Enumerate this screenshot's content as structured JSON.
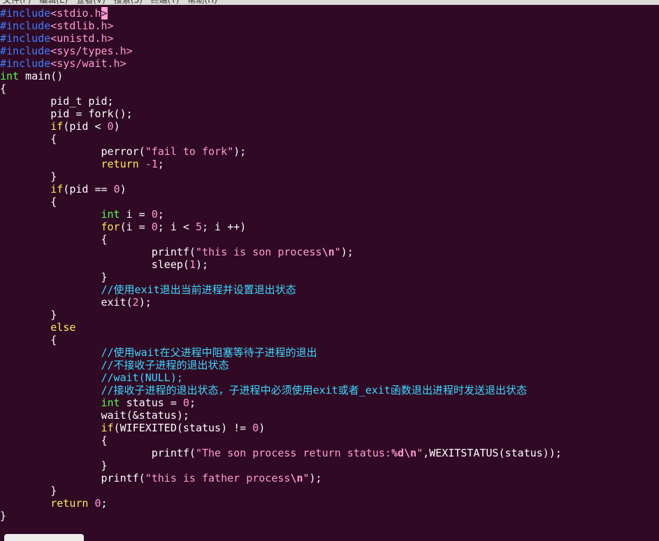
{
  "menubar": {
    "items": [
      "文件(F)",
      "编辑(E)",
      "查看(V)",
      "搜索(S)",
      "终端(T)",
      "帮助(H)"
    ]
  },
  "lines": [
    [
      {
        "c": "pre",
        "t": "#include"
      },
      {
        "c": "inc",
        "t": "<stdio.h"
      },
      {
        "c": "cursor",
        "t": ">"
      }
    ],
    [
      {
        "c": "pre",
        "t": "#include"
      },
      {
        "c": "inc",
        "t": "<stdlib.h>"
      }
    ],
    [
      {
        "c": "pre",
        "t": "#include"
      },
      {
        "c": "inc",
        "t": "<unistd.h>"
      }
    ],
    [
      {
        "c": "pre",
        "t": "#include"
      },
      {
        "c": "inc",
        "t": "<sys/types.h>"
      }
    ],
    [
      {
        "c": "pre",
        "t": "#include"
      },
      {
        "c": "inc",
        "t": "<sys/wait.h>"
      }
    ],
    [
      {
        "c": "type",
        "t": "int"
      },
      {
        "c": "",
        "t": " main()"
      }
    ],
    [
      {
        "c": "",
        "t": "{"
      }
    ],
    [
      {
        "c": "",
        "t": "        pid_t pid;"
      }
    ],
    [
      {
        "c": "",
        "t": "        pid = fork();"
      }
    ],
    [
      {
        "c": "",
        "t": "        "
      },
      {
        "c": "kw",
        "t": "if"
      },
      {
        "c": "",
        "t": "(pid < "
      },
      {
        "c": "num",
        "t": "0"
      },
      {
        "c": "",
        "t": ")"
      }
    ],
    [
      {
        "c": "",
        "t": "        {"
      }
    ],
    [
      {
        "c": "",
        "t": "                perror("
      },
      {
        "c": "str",
        "t": "\"fail to fork\""
      },
      {
        "c": "",
        "t": ");"
      }
    ],
    [
      {
        "c": "",
        "t": "                "
      },
      {
        "c": "kw",
        "t": "return"
      },
      {
        "c": "",
        "t": " "
      },
      {
        "c": "num",
        "t": "-1"
      },
      {
        "c": "",
        "t": ";"
      }
    ],
    [
      {
        "c": "",
        "t": "        }"
      }
    ],
    [
      {
        "c": "",
        "t": "        "
      },
      {
        "c": "kw",
        "t": "if"
      },
      {
        "c": "",
        "t": "(pid == "
      },
      {
        "c": "num",
        "t": "0"
      },
      {
        "c": "",
        "t": ")"
      }
    ],
    [
      {
        "c": "",
        "t": "        {"
      }
    ],
    [
      {
        "c": "",
        "t": "                "
      },
      {
        "c": "type",
        "t": "int"
      },
      {
        "c": "",
        "t": " i = "
      },
      {
        "c": "num",
        "t": "0"
      },
      {
        "c": "",
        "t": ";"
      }
    ],
    [
      {
        "c": "",
        "t": "                "
      },
      {
        "c": "kw",
        "t": "for"
      },
      {
        "c": "",
        "t": "(i = "
      },
      {
        "c": "num",
        "t": "0"
      },
      {
        "c": "",
        "t": "; i < "
      },
      {
        "c": "num",
        "t": "5"
      },
      {
        "c": "",
        "t": "; i ++)"
      }
    ],
    [
      {
        "c": "",
        "t": "                {"
      }
    ],
    [
      {
        "c": "",
        "t": "                        printf("
      },
      {
        "c": "str",
        "t": "\"this is son process"
      },
      {
        "c": "esc",
        "t": "\\n"
      },
      {
        "c": "str",
        "t": "\""
      },
      {
        "c": "",
        "t": ");"
      }
    ],
    [
      {
        "c": "",
        "t": "                        sleep("
      },
      {
        "c": "num",
        "t": "1"
      },
      {
        "c": "",
        "t": ");"
      }
    ],
    [
      {
        "c": "",
        "t": "                }"
      }
    ],
    [
      {
        "c": "",
        "t": "                "
      },
      {
        "c": "cmt",
        "t": "//使用exit退出当前进程并设置退出状态"
      }
    ],
    [
      {
        "c": "",
        "t": "                exit("
      },
      {
        "c": "num",
        "t": "2"
      },
      {
        "c": "",
        "t": ");"
      }
    ],
    [
      {
        "c": "",
        "t": "        }"
      }
    ],
    [
      {
        "c": "",
        "t": "        "
      },
      {
        "c": "kw",
        "t": "else"
      }
    ],
    [
      {
        "c": "",
        "t": "        {"
      }
    ],
    [
      {
        "c": "",
        "t": "                "
      },
      {
        "c": "cmt",
        "t": "//使用wait在父进程中阻塞等待子进程的退出"
      }
    ],
    [
      {
        "c": "",
        "t": "                "
      },
      {
        "c": "cmt",
        "t": "//不接收子进程的退出状态"
      }
    ],
    [
      {
        "c": "",
        "t": "                "
      },
      {
        "c": "cmt",
        "t": "//wait(NULL);"
      }
    ],
    [
      {
        "c": "",
        "t": "                "
      },
      {
        "c": "cmt",
        "t": "//接收子进程的退出状态，子进程中必须使用exit或者_exit函数退出进程时发送退出状态"
      }
    ],
    [
      {
        "c": "",
        "t": "                "
      },
      {
        "c": "type",
        "t": "int"
      },
      {
        "c": "",
        "t": " status = "
      },
      {
        "c": "num",
        "t": "0"
      },
      {
        "c": "",
        "t": ";"
      }
    ],
    [
      {
        "c": "",
        "t": "                wait(&status);"
      }
    ],
    [
      {
        "c": "",
        "t": "                "
      },
      {
        "c": "kw",
        "t": "if"
      },
      {
        "c": "",
        "t": "(WIFEXITED(status) != "
      },
      {
        "c": "num",
        "t": "0"
      },
      {
        "c": "",
        "t": ")"
      }
    ],
    [
      {
        "c": "",
        "t": "                {"
      }
    ],
    [
      {
        "c": "",
        "t": "                        printf("
      },
      {
        "c": "str",
        "t": "\"The son process return status:"
      },
      {
        "c": "esc",
        "t": "%d\\n"
      },
      {
        "c": "str",
        "t": "\""
      },
      {
        "c": "",
        "t": ",WEXITSTATUS(status));"
      }
    ],
    [
      {
        "c": "",
        "t": "                }"
      }
    ],
    [
      {
        "c": "",
        "t": "                printf("
      },
      {
        "c": "str",
        "t": "\"this is father process"
      },
      {
        "c": "esc",
        "t": "\\n"
      },
      {
        "c": "str",
        "t": "\""
      },
      {
        "c": "",
        "t": ");"
      }
    ],
    [
      {
        "c": "",
        "t": "        }"
      }
    ],
    [
      {
        "c": "",
        "t": "        "
      },
      {
        "c": "kw",
        "t": "return"
      },
      {
        "c": "",
        "t": " "
      },
      {
        "c": "num",
        "t": "0"
      },
      {
        "c": "",
        "t": ";"
      }
    ],
    [
      {
        "c": "",
        "t": "}"
      }
    ]
  ]
}
